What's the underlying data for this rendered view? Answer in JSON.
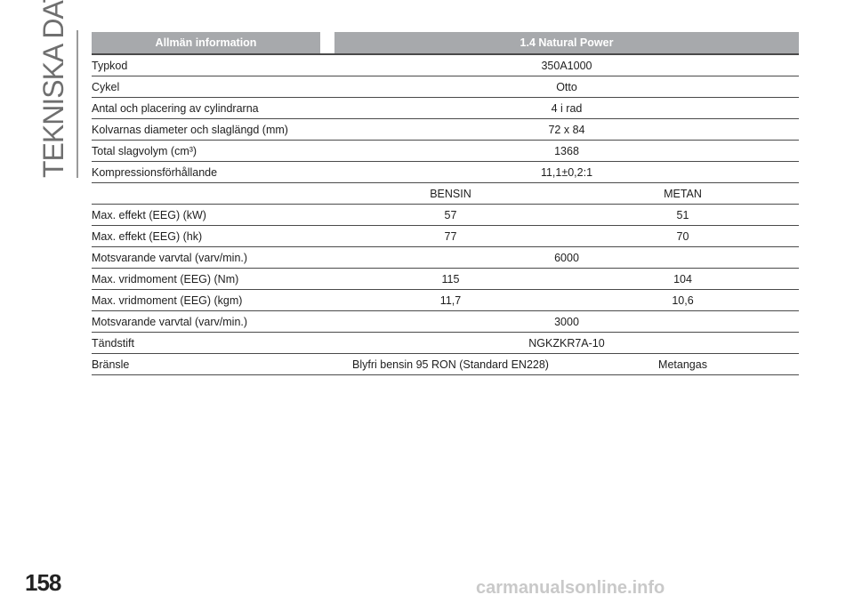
{
  "section_title": "TEKNISKA DATA",
  "page_number": "158",
  "watermark": "carmanualsonline.info",
  "table": {
    "header": {
      "left": "Allmän information",
      "right": "1.4 Natural Power"
    },
    "rows": [
      {
        "label": "Typkod",
        "value": "350A1000"
      },
      {
        "label": "Cykel",
        "value": "Otto"
      },
      {
        "label": "Antal och placering av cylindrarna",
        "value": "4 i rad"
      },
      {
        "label": "Kolvarnas diameter och slaglängd (mm)",
        "value": "72 x 84"
      },
      {
        "label": "Total slagvolym (cm³)",
        "value": "1368"
      },
      {
        "label": "Kompressionsförhållande",
        "value": "11,1±0,2:1"
      },
      {
        "label": "",
        "a": "BENSIN",
        "b": "METAN"
      },
      {
        "label": "Max. effekt (EEG) (kW)",
        "a": "57",
        "b": "51"
      },
      {
        "label": "Max. effekt (EEG) (hk)",
        "a": "77",
        "b": "70"
      },
      {
        "label": "Motsvarande varvtal (varv/min.)",
        "value": "6000"
      },
      {
        "label": "Max. vridmoment (EEG) (Nm)",
        "a": "115",
        "b": "104"
      },
      {
        "label": "Max. vridmoment (EEG) (kgm)",
        "a": "11,7",
        "b": "10,6"
      },
      {
        "label": "Motsvarande varvtal (varv/min.)",
        "value": "3000"
      },
      {
        "label": "Tändstift",
        "value": "NGKZKR7A-10"
      },
      {
        "label": "Bränsle",
        "a": "Blyfri bensin 95 RON (Standard EN228)",
        "b": "Metangas"
      }
    ]
  }
}
